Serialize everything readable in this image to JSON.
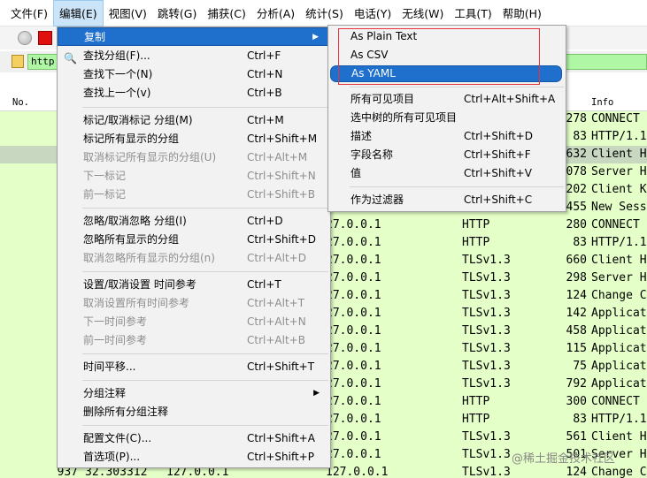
{
  "menubar": {
    "items": [
      "文件(F)",
      "编辑(E)",
      "视图(V)",
      "跳转(G)",
      "捕获(C)",
      "分析(A)",
      "统计(S)",
      "电话(Y)",
      "无线(W)",
      "工具(T)",
      "帮助(H)"
    ]
  },
  "filter": {
    "value": "http"
  },
  "packet_list": {
    "headers": {
      "no": "No.",
      "info": "Info"
    },
    "rows": [
      {
        "no": "",
        "time": "",
        "src": "",
        "dst": "",
        "proto": "",
        "len": "278",
        "info": "CONNECT"
      },
      {
        "no": "",
        "time": "",
        "src": "",
        "dst": "",
        "proto": "",
        "len": "83",
        "info": "HTTP/1.1"
      },
      {
        "no": "",
        "time": "",
        "src": "",
        "dst": "",
        "proto": "",
        "len": "632",
        "info": "Client H"
      },
      {
        "no": "",
        "time": "",
        "src": "",
        "dst": "",
        "proto": "",
        "len": "078",
        "info": "Server H"
      },
      {
        "no": "",
        "time": "",
        "src": "",
        "dst": "",
        "proto": "",
        "len": "202",
        "info": "Client K"
      },
      {
        "no": "",
        "time": "",
        "src": "",
        "dst": "",
        "proto": "",
        "len": "455",
        "info": "New Sess"
      },
      {
        "no": "",
        "time": "",
        "src": "",
        "dst": "27.0.0.1",
        "proto": "HTTP",
        "len": "280",
        "info": "CONNECT"
      },
      {
        "no": "",
        "time": "",
        "src": "",
        "dst": "27.0.0.1",
        "proto": "HTTP",
        "len": "83",
        "info": "HTTP/1.1"
      },
      {
        "no": "",
        "time": "",
        "src": "",
        "dst": "27.0.0.1",
        "proto": "TLSv1.3",
        "len": "660",
        "info": "Client H"
      },
      {
        "no": "",
        "time": "",
        "src": "",
        "dst": "27.0.0.1",
        "proto": "TLSv1.3",
        "len": "298",
        "info": "Server H"
      },
      {
        "no": "",
        "time": "",
        "src": "",
        "dst": "27.0.0.1",
        "proto": "TLSv1.3",
        "len": "124",
        "info": "Change C"
      },
      {
        "no": "",
        "time": "",
        "src": "",
        "dst": "27.0.0.1",
        "proto": "TLSv1.3",
        "len": "142",
        "info": "Applicat"
      },
      {
        "no": "",
        "time": "",
        "src": "",
        "dst": "27.0.0.1",
        "proto": "TLSv1.3",
        "len": "458",
        "info": "Applicat"
      },
      {
        "no": "",
        "time": "",
        "src": "",
        "dst": "27.0.0.1",
        "proto": "TLSv1.3",
        "len": "115",
        "info": "Applicat"
      },
      {
        "no": "",
        "time": "",
        "src": "",
        "dst": "27.0.0.1",
        "proto": "TLSv1.3",
        "len": "75",
        "info": "Applicat"
      },
      {
        "no": "",
        "time": "",
        "src": "",
        "dst": "27.0.0.1",
        "proto": "TLSv1.3",
        "len": "792",
        "info": "Applicat"
      },
      {
        "no": "",
        "time": "",
        "src": "",
        "dst": "27.0.0.1",
        "proto": "HTTP",
        "len": "300",
        "info": "CONNECT"
      },
      {
        "no": "",
        "time": "",
        "src": "",
        "dst": "27.0.0.1",
        "proto": "HTTP",
        "len": "83",
        "info": "HTTP/1.1"
      },
      {
        "no": "",
        "time": "",
        "src": "",
        "dst": "27.0.0.1",
        "proto": "TLSv1.3",
        "len": "561",
        "info": "Client H"
      },
      {
        "no": "",
        "time": "",
        "src": "",
        "dst": "27.0.0.1",
        "proto": "TLSv1.3",
        "len": "501",
        "info": "Server H"
      },
      {
        "no": "937",
        "time": "32.303312",
        "src": "127.0.0.1",
        "dst": "127.0.0.1",
        "proto": "TLSv1.3",
        "len": "124",
        "info": "Change C"
      }
    ]
  },
  "edit_menu": {
    "copy": "复制",
    "find_packet": "查找分组(F)...",
    "find_packet_sc": "Ctrl+F",
    "find_next": "查找下一个(N)",
    "find_next_sc": "Ctrl+N",
    "find_prev": "查找上一个(v)",
    "find_prev_sc": "Ctrl+B",
    "mark": "标记/取消标记 分组(M)",
    "mark_sc": "Ctrl+M",
    "mark_all": "标记所有显示的分组",
    "mark_all_sc": "Ctrl+Shift+M",
    "unmark_all": "取消标记所有显示的分组(U)",
    "unmark_all_sc": "Ctrl+Alt+M",
    "next_mark": "下一标记",
    "next_mark_sc": "Ctrl+Shift+N",
    "prev_mark": "前一标记",
    "prev_mark_sc": "Ctrl+Shift+B",
    "ignore": "忽略/取消忽略 分组(I)",
    "ignore_sc": "Ctrl+D",
    "ignore_all": "忽略所有显示的分组",
    "ignore_all_sc": "Ctrl+Shift+D",
    "unignore_all": "取消忽略所有显示的分组(n)",
    "unignore_all_sc": "Ctrl+Alt+D",
    "time_ref": "设置/取消设置 时间参考",
    "time_ref_sc": "Ctrl+T",
    "unset_time_ref": "取消设置所有时间参考",
    "unset_time_ref_sc": "Ctrl+Alt+T",
    "next_time_ref": "下一时间参考",
    "next_time_ref_sc": "Ctrl+Alt+N",
    "prev_time_ref": "前一时间参考",
    "prev_time_ref_sc": "Ctrl+Alt+B",
    "time_shift": "时间平移...",
    "time_shift_sc": "Ctrl+Shift+T",
    "packet_comment": "分组注释",
    "delete_comments": "删除所有分组注释",
    "profiles": "配置文件(C)...",
    "profiles_sc": "Ctrl+Shift+A",
    "preferences": "首选项(P)...",
    "preferences_sc": "Ctrl+Shift+P"
  },
  "copy_submenu": {
    "plain_text": "As Plain Text",
    "csv": "As CSV",
    "yaml": "As YAML",
    "all_visible": "所有可见项目",
    "all_visible_sc": "Ctrl+Alt+Shift+A",
    "all_visible_selected_tree": "选中树的所有可见项目",
    "description": "描述",
    "description_sc": "Ctrl+Shift+D",
    "field_name": "字段名称",
    "field_name_sc": "Ctrl+Shift+F",
    "value": "值",
    "value_sc": "Ctrl+Shift+V",
    "as_filter": "作为过滤器",
    "as_filter_sc": "Ctrl+Shift+C"
  },
  "watermark": "@稀土掘金技术社区",
  "colors": {
    "row_bg": "#e4ffc7",
    "highlight": "#1f6fcc",
    "filter_bg": "#aff7a5",
    "annotation": "#e8323c"
  }
}
